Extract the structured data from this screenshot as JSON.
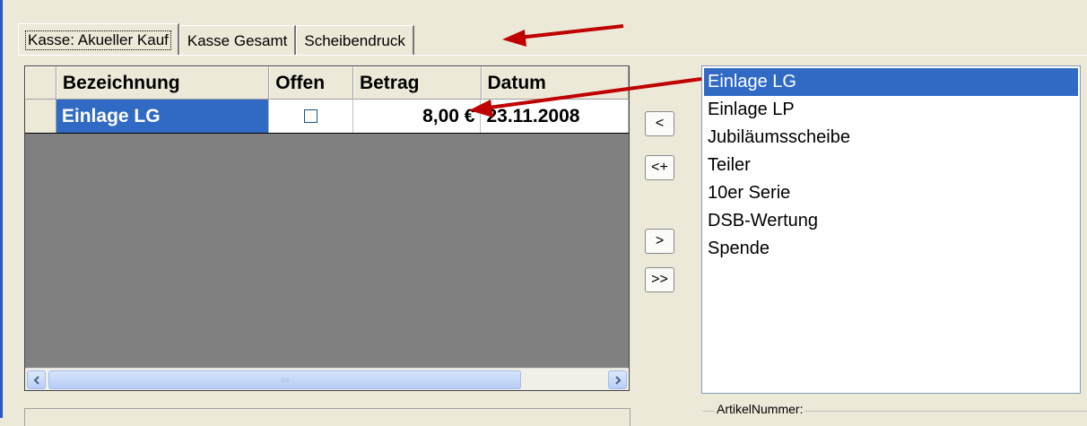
{
  "tabs": [
    "Kasse: Akueller Kauf",
    "Kasse Gesamt",
    "Scheibendruck"
  ],
  "grid": {
    "columns": [
      "Bezeichnung",
      "Offen",
      "Betrag",
      "Datum"
    ],
    "rows": [
      {
        "bezeichnung": "Einlage LG",
        "offen": false,
        "betrag": "8,00 €",
        "datum": "23.11.2008"
      }
    ],
    "scroll_left_icon": "chevron-left-icon",
    "scroll_right_icon": "chevron-right-icon"
  },
  "buttons": {
    "move_left": "<",
    "add_left": "<+",
    "move_right": ">",
    "move_all_right": ">>"
  },
  "list_items": [
    "Einlage LG",
    "Einlage LP",
    "Jubiläumsscheibe",
    "Teiler",
    "10er Serie",
    "DSB-Wertung",
    "Spende"
  ],
  "selected_item": "Einlage LG",
  "artikel_label": "ArtikelNummer:",
  "colors": {
    "accent": "#316ac5",
    "background": "#ece9d8",
    "annotation_arrow": "#c00000"
  }
}
